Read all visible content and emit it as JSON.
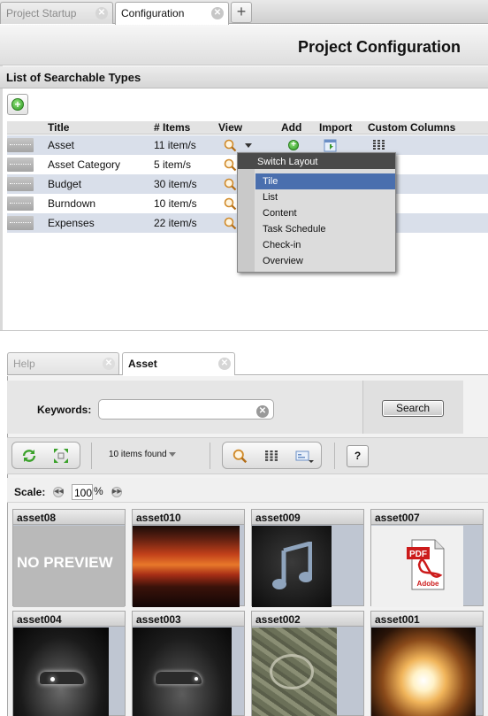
{
  "top_tabs": [
    {
      "label": "Project Startup",
      "active": false
    },
    {
      "label": "Configuration",
      "active": true
    }
  ],
  "header": {
    "title": "Project Configuration"
  },
  "section": {
    "title": "List of Searchable Types"
  },
  "table": {
    "columns": [
      "Title",
      "# Items",
      "View",
      "Add",
      "Import",
      "Custom Columns"
    ],
    "rows": [
      {
        "title": "Asset",
        "items": "11 item/s"
      },
      {
        "title": "Asset Category",
        "items": "5 item/s"
      },
      {
        "title": "Budget",
        "items": "30 item/s"
      },
      {
        "title": "Burndown",
        "items": "10 item/s"
      },
      {
        "title": "Expenses",
        "items": "22 item/s"
      }
    ]
  },
  "popup": {
    "title": "Switch Layout",
    "items": [
      "Tile",
      "List",
      "Content",
      "Task Schedule",
      "Check-in",
      "Overview"
    ],
    "selected": "Tile"
  },
  "lower_tabs": [
    {
      "label": "Help",
      "active": false
    },
    {
      "label": "Asset",
      "active": true
    }
  ],
  "search": {
    "keywords_label": "Keywords:",
    "keywords_value": "",
    "button_label": "Search"
  },
  "toolbar": {
    "items_found": "10 items found",
    "help_label": "?"
  },
  "scale": {
    "label": "Scale:",
    "value": "100",
    "unit": "%"
  },
  "tiles": [
    {
      "name": "asset08",
      "preview": "NO PREVIEW"
    },
    {
      "name": "asset010",
      "preview": ""
    },
    {
      "name": "asset009",
      "preview": ""
    },
    {
      "name": "asset007",
      "preview": ""
    },
    {
      "name": "asset004",
      "preview": ""
    },
    {
      "name": "asset003",
      "preview": ""
    },
    {
      "name": "asset002",
      "preview": ""
    },
    {
      "name": "asset001",
      "preview": ""
    }
  ],
  "pdf_icon": {
    "badge": "PDF",
    "brand": "Adobe"
  },
  "colors": {
    "row_alt": "#d9dfea",
    "selected": "#4a6fae",
    "popup_header": "#4a4a4a"
  }
}
